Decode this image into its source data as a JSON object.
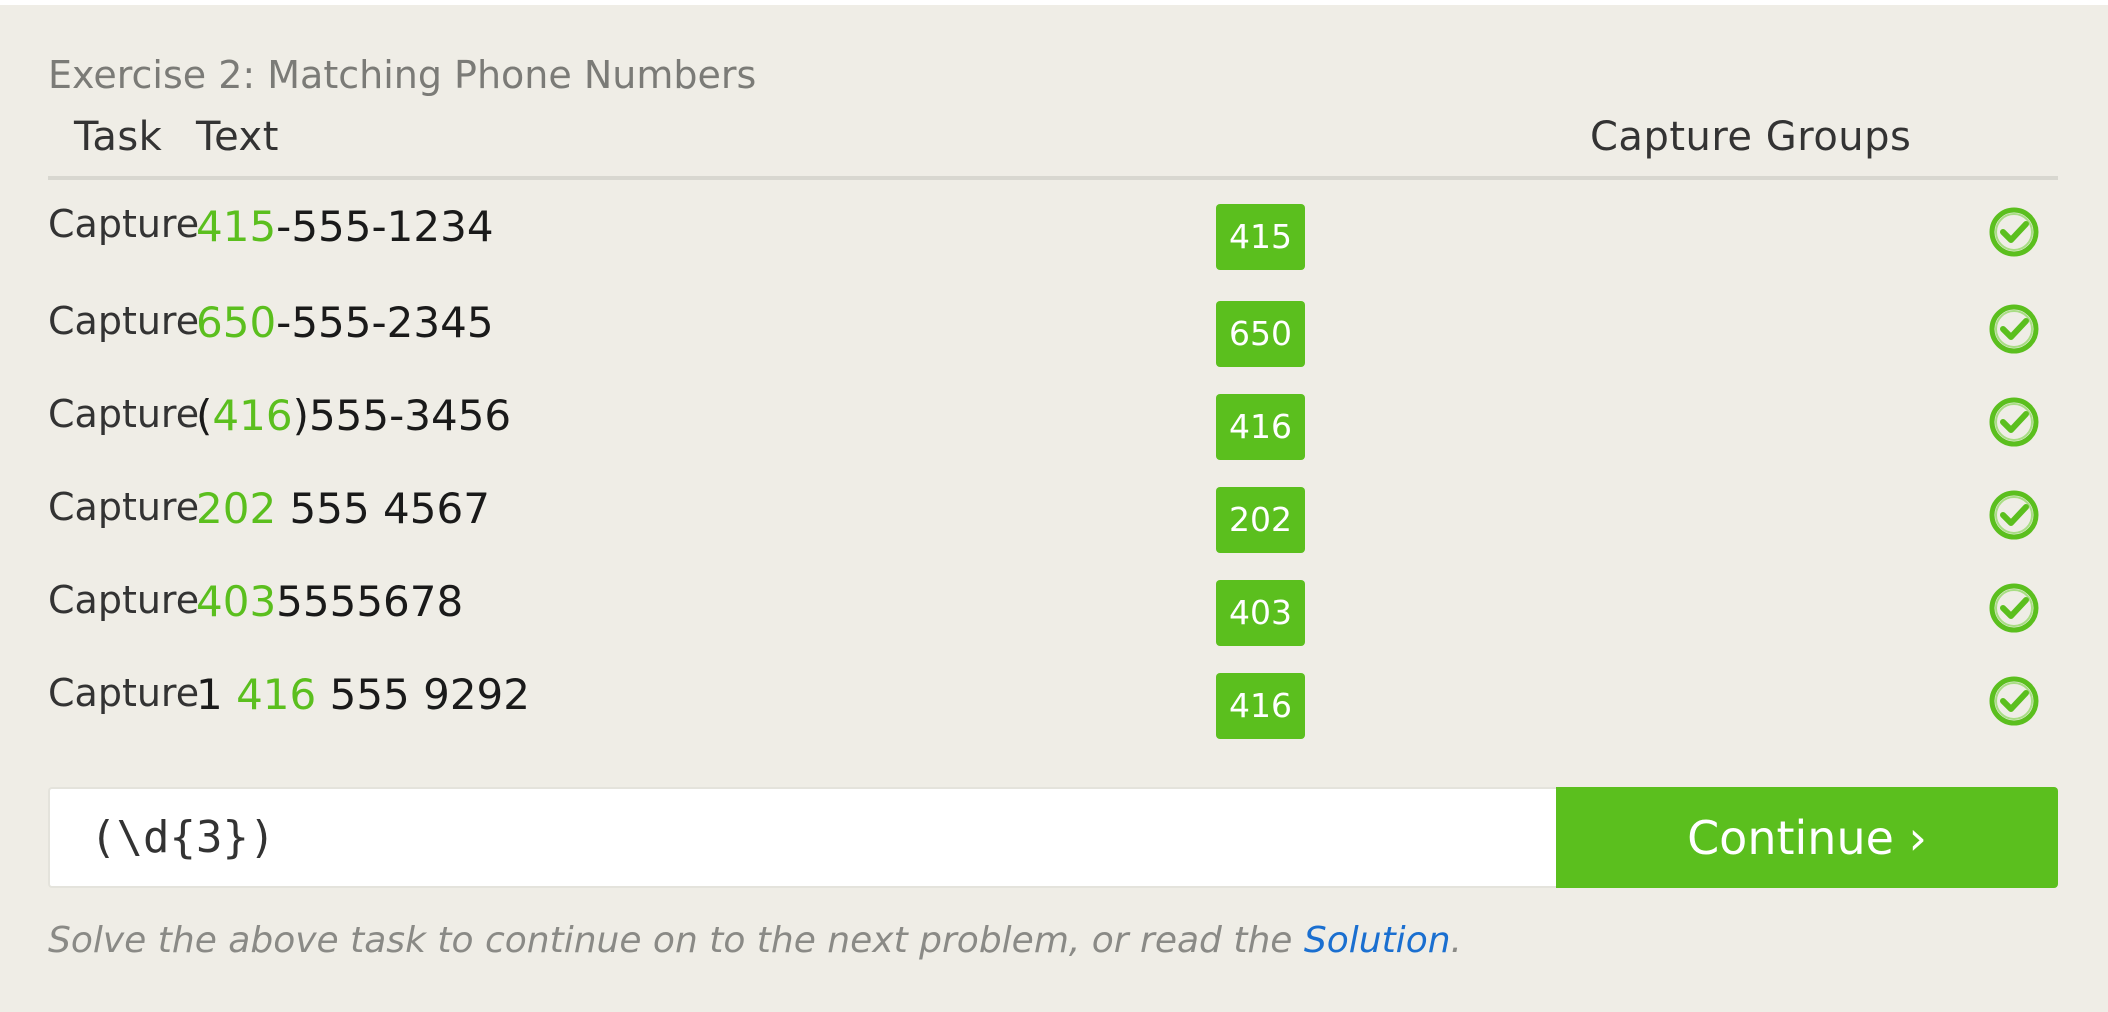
{
  "exercise": {
    "title": "Exercise 2: Matching Phone Numbers",
    "headers": {
      "task": "Task",
      "text": "Text",
      "capture_groups": "Capture Groups"
    },
    "rows": [
      {
        "task": "Capture",
        "text_pre": "",
        "text_match": "415",
        "text_post": "-555-1234",
        "capture": "415",
        "status": "check-circle-icon"
      },
      {
        "task": "Capture",
        "text_pre": "",
        "text_match": "650",
        "text_post": "-555-2345",
        "capture": "650",
        "status": "check-circle-icon"
      },
      {
        "task": "Capture",
        "text_pre": "(",
        "text_match": "416",
        "text_post": ")555-3456",
        "capture": "416",
        "status": "check-circle-icon"
      },
      {
        "task": "Capture",
        "text_pre": "",
        "text_match": "202",
        "text_post": " 555 4567",
        "capture": "202",
        "status": "check-circle-icon"
      },
      {
        "task": "Capture",
        "text_pre": "",
        "text_match": "403",
        "text_post": "5555678",
        "capture": "403",
        "status": "check-circle-icon"
      },
      {
        "task": "Capture",
        "text_pre": "1 ",
        "text_match": "416",
        "text_post": " 555 9292",
        "capture": "416",
        "status": "check-circle-icon"
      }
    ],
    "input": {
      "value": "(\\d{3})"
    },
    "continue_label": "Continue ›",
    "help": {
      "prefix": "Solve the above task to continue on to the next problem, or read the ",
      "link": "Solution",
      "suffix": "."
    }
  },
  "colors": {
    "background": "#efede6",
    "accent_green": "#5bbf1e",
    "link_blue": "#1a6fd0"
  }
}
